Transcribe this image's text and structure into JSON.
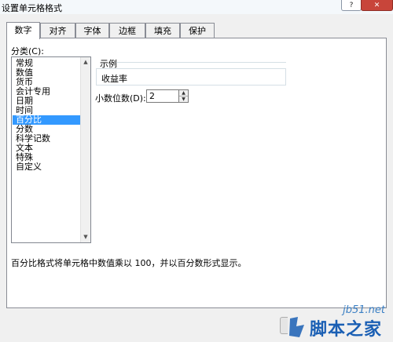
{
  "window": {
    "title": "设置单元格格式",
    "help_label": "?",
    "close_label": "✕"
  },
  "tabs": [
    {
      "label": "数字",
      "active": true
    },
    {
      "label": "对齐",
      "active": false
    },
    {
      "label": "字体",
      "active": false
    },
    {
      "label": "边框",
      "active": false
    },
    {
      "label": "填充",
      "active": false
    },
    {
      "label": "保护",
      "active": false
    }
  ],
  "category": {
    "label": "分类(C):",
    "items": [
      "常规",
      "数值",
      "货币",
      "会计专用",
      "日期",
      "时间",
      "百分比",
      "分数",
      "科学记数",
      "文本",
      "特殊",
      "自定义"
    ],
    "selected_index": 6
  },
  "sample": {
    "label": "示例",
    "value": "收益率"
  },
  "decimal": {
    "label": "小数位数(D):",
    "value": "2"
  },
  "description": "百分比格式将单元格中数值乘以 100，并以百分数形式显示。",
  "watermark": {
    "url": "jb51.net",
    "name": "脚本之家"
  },
  "colors": {
    "selection": "#3399ff",
    "watermark": "#1a5fb4",
    "close": "#c8453a"
  }
}
